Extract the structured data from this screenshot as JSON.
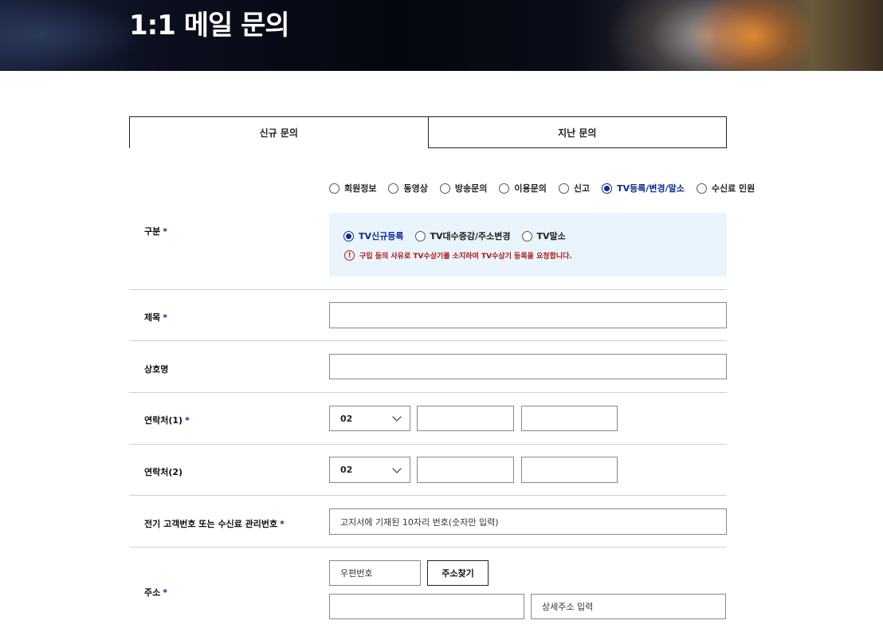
{
  "hero": {
    "title": "1:1 메일 문의"
  },
  "tabs": [
    {
      "label": "신규 문의",
      "active": true
    },
    {
      "label": "지난 문의",
      "active": false
    }
  ],
  "category": {
    "label": "구분",
    "required_mark": "*",
    "options": [
      {
        "label": "회원정보",
        "checked": false
      },
      {
        "label": "동영상",
        "checked": false
      },
      {
        "label": "방송문의",
        "checked": false
      },
      {
        "label": "이용문의",
        "checked": false
      },
      {
        "label": "신고",
        "checked": false
      },
      {
        "label": "TV등록/변경/말소",
        "checked": true
      },
      {
        "label": "수신료 민원",
        "checked": false
      }
    ],
    "sub_options": [
      {
        "label": "TV신규등록",
        "checked": true
      },
      {
        "label": "TV대수증감/주소변경",
        "checked": false
      },
      {
        "label": "TV말소",
        "checked": false
      }
    ],
    "notice": "구입 등의 사유로 TV수상기를 소지하여 TV수상기 등록을 요청합니다.",
    "notice_icon": "info-icon"
  },
  "subject": {
    "label": "제목",
    "required_mark": "*",
    "value": ""
  },
  "company": {
    "label": "상호명",
    "value": ""
  },
  "phone1": {
    "label": "연락처(1)",
    "required_mark": "*",
    "area_code": "02",
    "middle": "",
    "last": ""
  },
  "phone2": {
    "label": "연락처(2)",
    "area_code": "02",
    "middle": "",
    "last": ""
  },
  "customer_no": {
    "label": "전기 고객번호 또는 수신료 관리번호",
    "required_mark": "*",
    "placeholder": "고지서에 기재된 10자리 번호(숫자만 입력)"
  },
  "address": {
    "label": "주소",
    "required_mark": "*",
    "zipcode_placeholder": "우편번호",
    "search_button": "주소찾기",
    "address1": "",
    "detail_placeholder": "상세주소 입력"
  },
  "colors": {
    "accent": "#0b2c8f",
    "notice_red": "#b01515",
    "subbox_bg": "#e9f4fc"
  }
}
